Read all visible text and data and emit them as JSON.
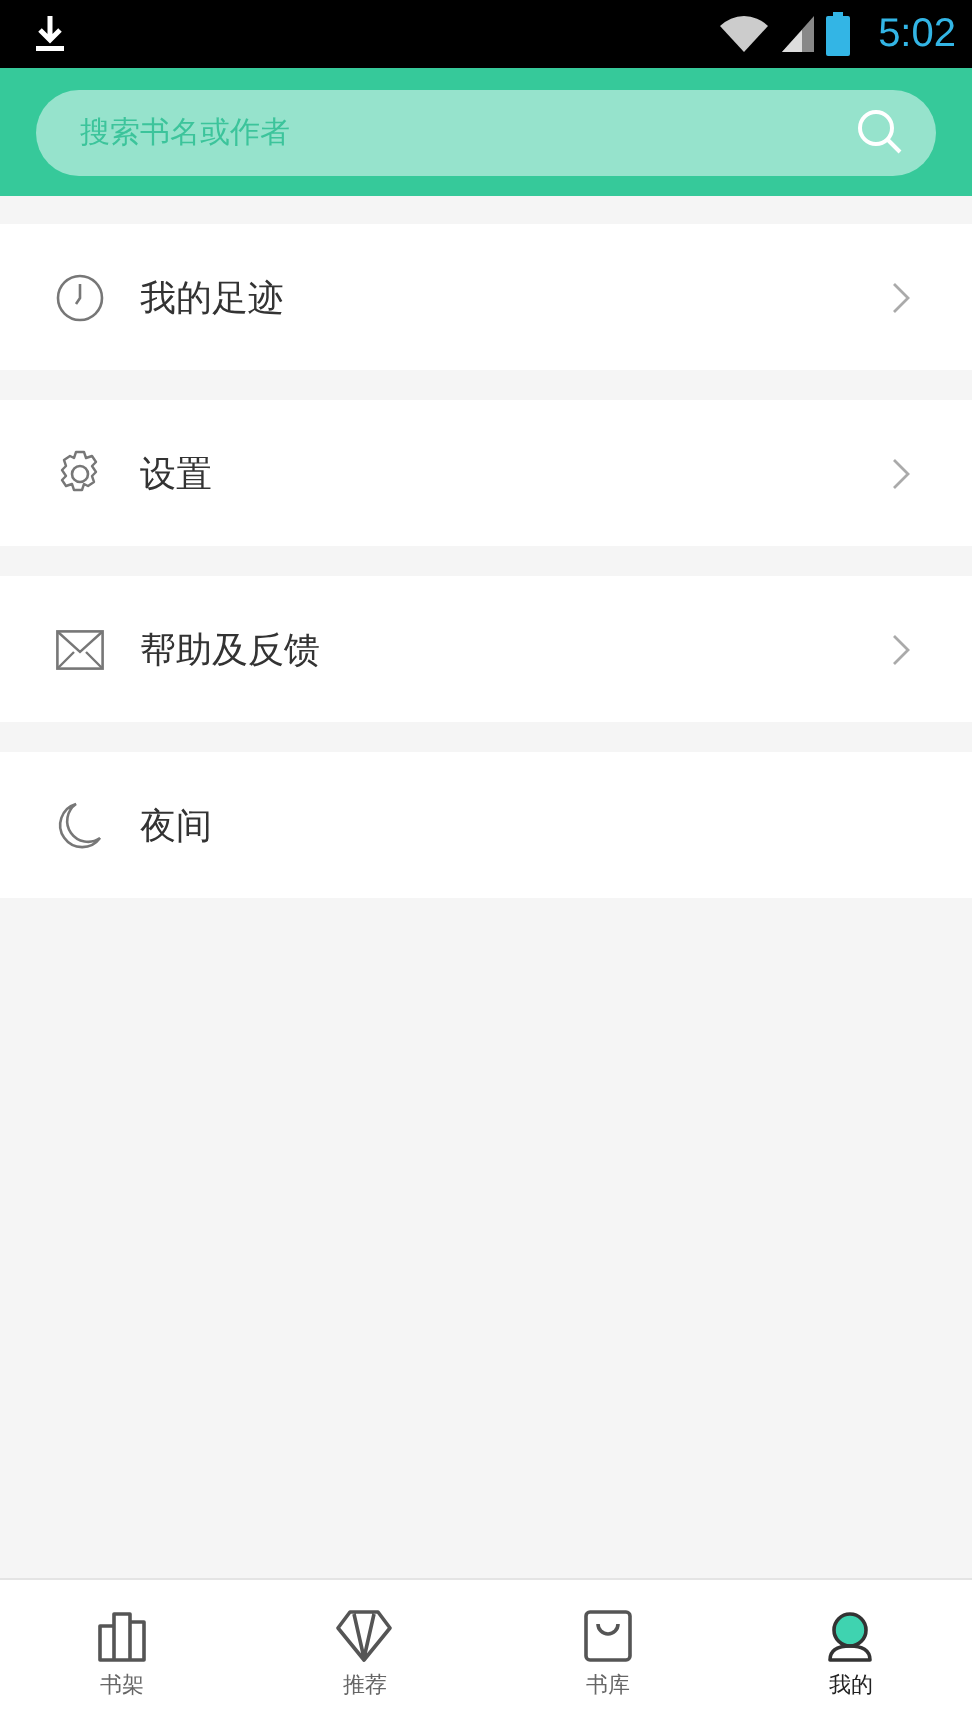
{
  "status_bar": {
    "time": "5:02"
  },
  "search": {
    "placeholder": "搜索书名或作者"
  },
  "menu": [
    {
      "label": "我的足迹",
      "kind": "clock",
      "chevron": true
    },
    {
      "label": "设置",
      "kind": "gear",
      "chevron": true
    },
    {
      "label": "帮助及反馈",
      "kind": "mail",
      "chevron": true
    },
    {
      "label": "夜间",
      "kind": "moon",
      "chevron": false
    }
  ],
  "tabs": [
    {
      "label": "书架",
      "kind": "shelf",
      "selected": false
    },
    {
      "label": "推荐",
      "kind": "diamond",
      "selected": false
    },
    {
      "label": "书库",
      "kind": "bag",
      "selected": false
    },
    {
      "label": "我的",
      "kind": "user",
      "selected": true
    }
  ]
}
